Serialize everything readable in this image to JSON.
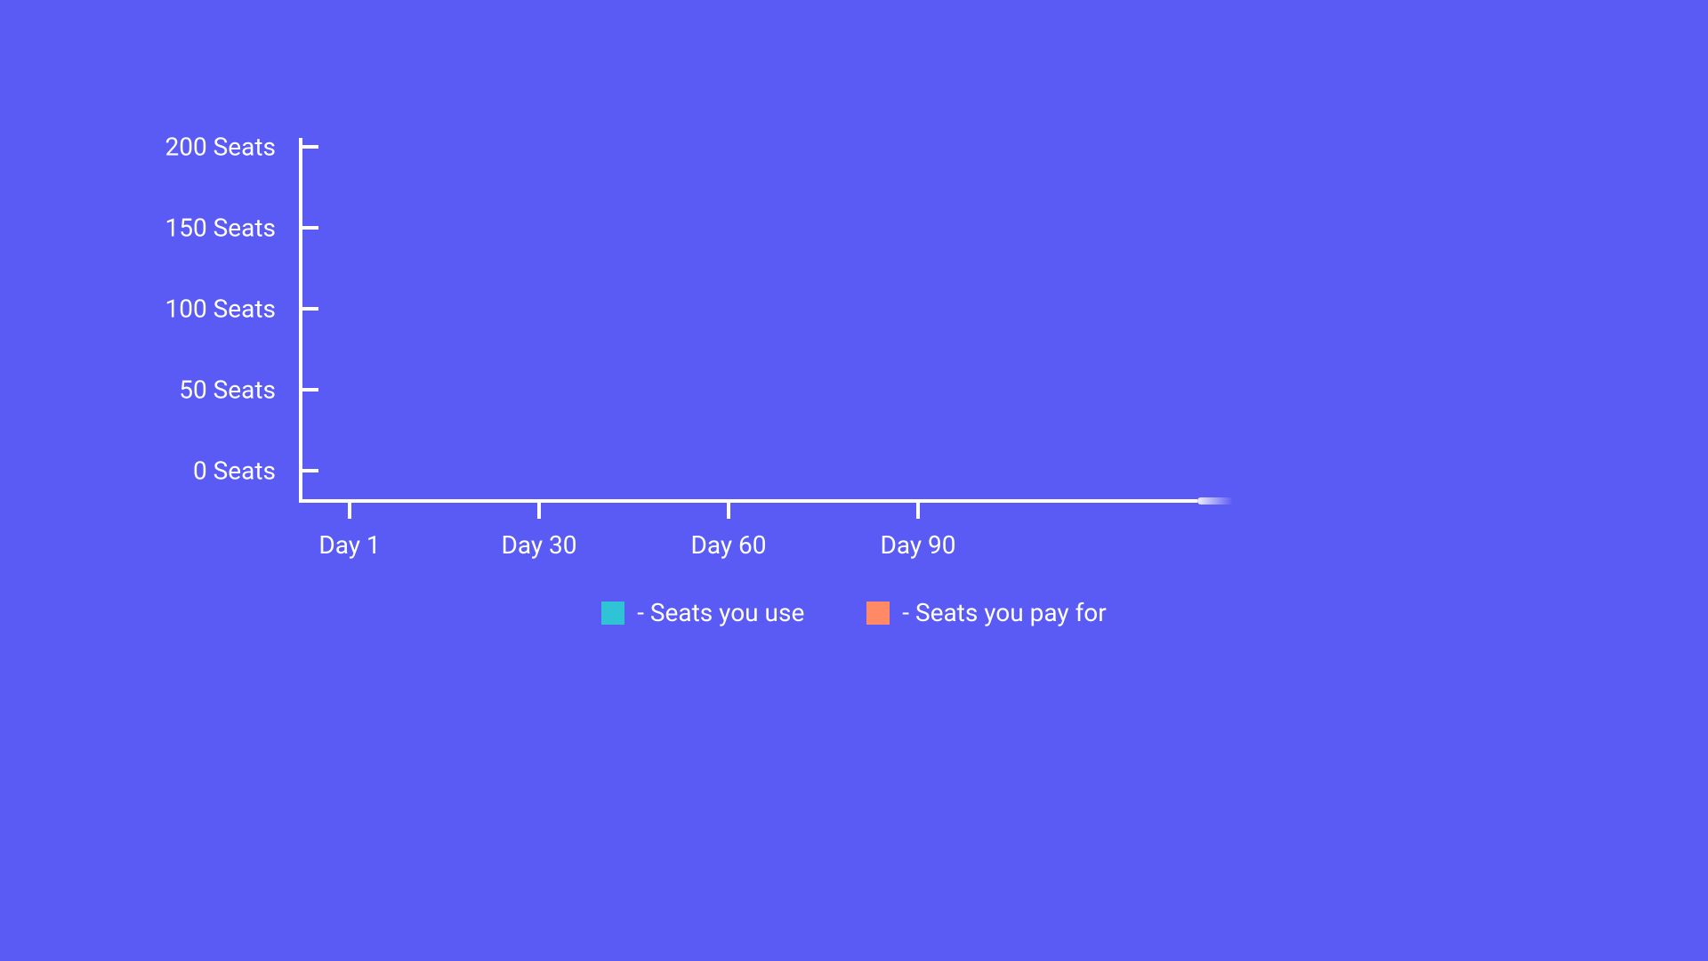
{
  "chart_data": {
    "type": "line",
    "title": "",
    "xlabel": "",
    "ylabel": "",
    "ylim": [
      0,
      200
    ],
    "x_ticks": [
      "Day 1",
      "Day 30",
      "Day 60",
      "Day 90"
    ],
    "y_ticks": [
      "0 Seats",
      "50 Seats",
      "100 Seats",
      "150 Seats",
      "200 Seats"
    ],
    "series": [
      {
        "name": "Seats you use",
        "color": "#2fc3d6",
        "values": []
      },
      {
        "name": "Seats you pay for",
        "color": "#ff8a65",
        "values": []
      }
    ],
    "legend_position": "bottom",
    "grid": false
  },
  "axis": {
    "y_labels": {
      "t200": "200 Seats",
      "t150": "150 Seats",
      "t100": "100 Seats",
      "t50": "50 Seats",
      "t0": "0 Seats"
    },
    "x_labels": {
      "d1": "Day 1",
      "d30": "Day 30",
      "d60": "Day 60",
      "d90": "Day 90"
    }
  },
  "legend": {
    "use_label": "- Seats you use",
    "pay_label": "- Seats you pay for"
  }
}
